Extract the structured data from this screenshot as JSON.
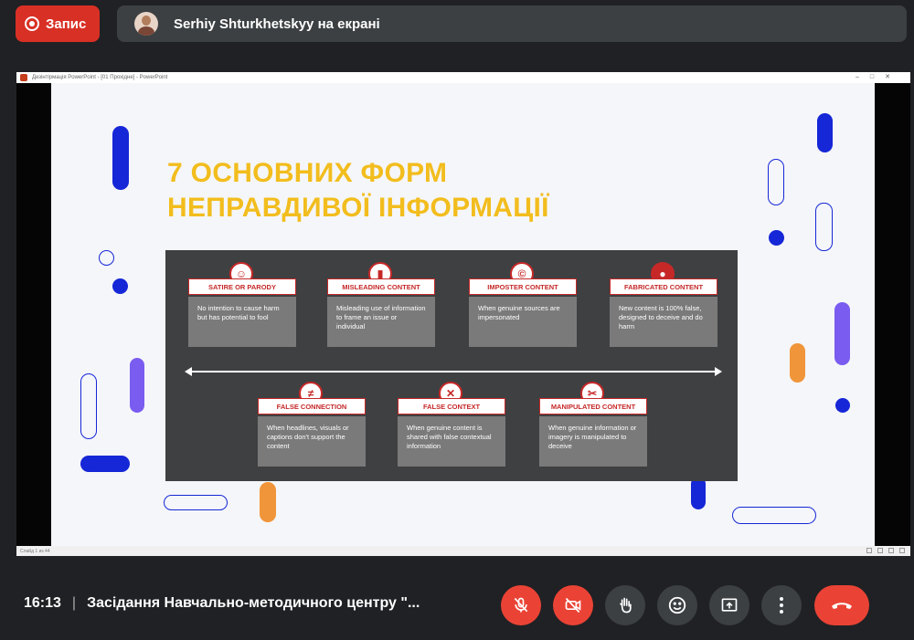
{
  "top_bar": {
    "record_label": "Запис",
    "presenter_text": "Serhiy Shturkhetskyy на екрані"
  },
  "presentation": {
    "window_title": "Дезінтірмація PowerPoint - [01 Прохідне] - PowerPoint",
    "status_text": "Слайд 1 из 44",
    "slide": {
      "title": "7 ОСНОВНИХ ФОРМ\nНЕПРАВДИВОЇ ІНФОРМАЦІЇ",
      "accent_color": "#f2bd1d",
      "card_label_color": "#c62828",
      "top_row": [
        {
          "label": "SATIRE OR PARODY",
          "description": "No intention to cause harm but has potential to fool",
          "icon": "jester-icon"
        },
        {
          "label": "MISLEADING CONTENT",
          "description": "Misleading use of information to frame an issue or individual",
          "icon": "ruler-icon"
        },
        {
          "label": "IMPOSTER CONTENT",
          "description": "When genuine sources are impersonated",
          "icon": "copyright-icon"
        },
        {
          "label": "FABRICATED CONTENT",
          "description": "New content is 100% false, designed to deceive and do harm",
          "icon": "masked-face-icon"
        }
      ],
      "bottom_row": [
        {
          "label": "FALSE CONNECTION",
          "description": "When headlines, visuals or captions don't support the content",
          "icon": "not-equal-icon",
          "glyph": "≠"
        },
        {
          "label": "FALSE CONTEXT",
          "description": "When genuine content is shared with false contextual information",
          "icon": "speech-bubble-x-icon"
        },
        {
          "label": "MANIPULATED CONTENT",
          "description": "When genuine information or imagery is manipulated to deceive",
          "icon": "scissors-icon"
        }
      ]
    }
  },
  "bottom_bar": {
    "time": "16:13",
    "separator": "|",
    "meeting_title": "Засідання Навчально-методичного центру \"...",
    "controls": [
      "mic-off-icon",
      "camera-off-icon",
      "raise-hand-icon",
      "emoji-icon",
      "present-icon",
      "more-options-icon",
      "end-call-icon"
    ]
  }
}
